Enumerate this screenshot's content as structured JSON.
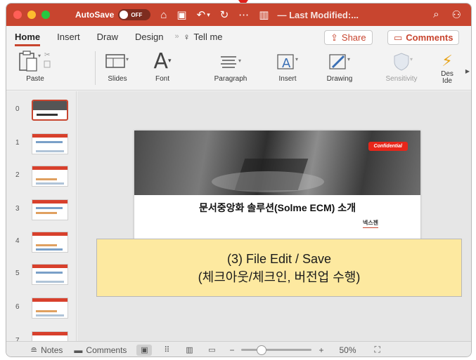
{
  "titlebar": {
    "autosave_label": "AutoSave",
    "autosave_state": "OFF",
    "doc_title": "— Last Modified:..."
  },
  "tabs": [
    {
      "label": "Home",
      "active": true
    },
    {
      "label": "Insert"
    },
    {
      "label": "Draw"
    },
    {
      "label": "Design"
    }
  ],
  "tell_me": "Tell me",
  "share_label": "Share",
  "comments_label": "Comments",
  "ribbon": {
    "paste": "Paste",
    "slides": "Slides",
    "font": "Font",
    "paragraph": "Paragraph",
    "insert": "Insert",
    "drawing": "Drawing",
    "sensitivity": "Sensitivity",
    "designer_line1": "Des",
    "designer_line2": "Ide"
  },
  "thumbnails": [
    "0",
    "1",
    "2",
    "3",
    "4",
    "5",
    "6",
    "7"
  ],
  "slide": {
    "confidential": "Confidential",
    "title": "문서중앙화 솔루션(Solme ECM) 소개",
    "author": "넥스젠"
  },
  "callout": {
    "line1": "(3) File Edit / Save",
    "line2": "(체크아웃/체크인, 버전업 수행)"
  },
  "statusbar": {
    "notes": "Notes",
    "comments": "Comments",
    "zoom": "50%",
    "zoom_level": 0.5
  },
  "colors": {
    "accent": "#c8452f",
    "callout_bg": "#fde9a0",
    "confidential_bg": "#e8261a"
  }
}
